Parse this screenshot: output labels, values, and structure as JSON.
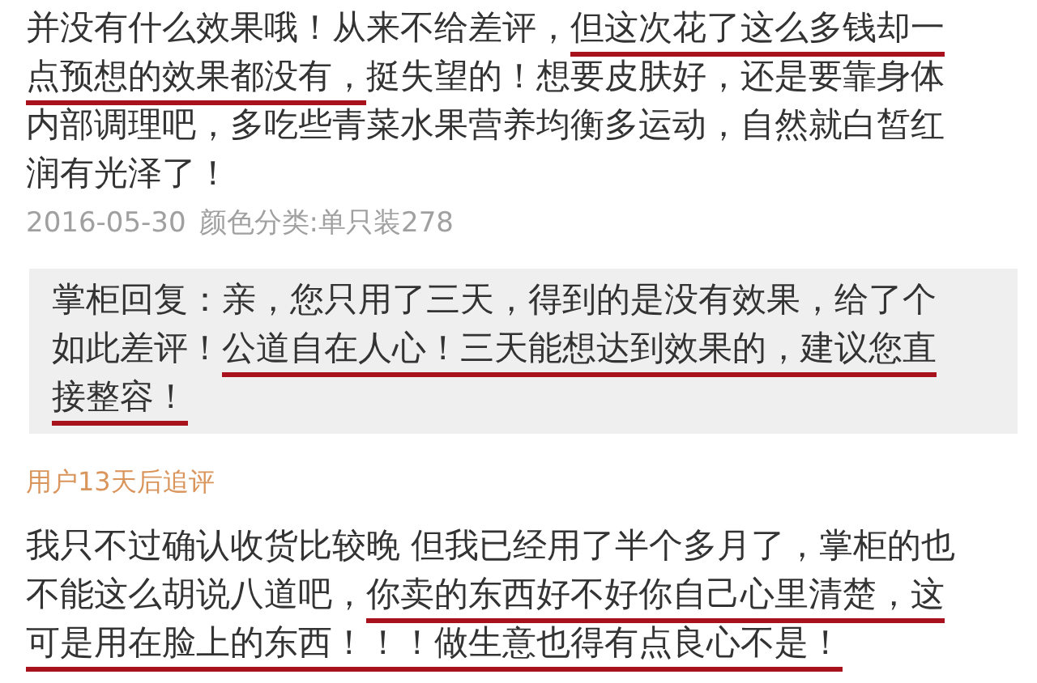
{
  "review": {
    "segments": [
      {
        "text": "并没有什么效果哦！从来不给差评，",
        "underlined": false
      },
      {
        "text": "但这次花了这么多钱却一点预想的效果都没有，",
        "underlined": true
      },
      {
        "text": "挺失望的！想要皮肤好，还是要靠身体内部调理吧，多吃些青菜水果营养均衡多运动，自然就白皙红润有光泽了！",
        "underlined": false
      }
    ],
    "date": "2016-05-30",
    "variant": "颜色分类:单只装278"
  },
  "seller_reply": {
    "segments": [
      {
        "text": "掌柜回复：亲，您只用了三天，得到的是没有效果，给了个如此差评！",
        "underlined": false
      },
      {
        "text": "公道自在人心！三天能想达到效果的，建议您直接整容！",
        "underlined": true
      }
    ]
  },
  "follow_up": {
    "label": "用户13天后追评",
    "segments": [
      {
        "text": "我只不过确认收货比较晚 但我已经用了半个多月了，掌柜的也不能这么胡说八道吧，",
        "underlined": false
      },
      {
        "text": "你卖的东西好不好你自己心里清楚，这可是用在脸上的东西！！！做生意也得有点良心不是！",
        "underlined": true
      }
    ]
  }
}
